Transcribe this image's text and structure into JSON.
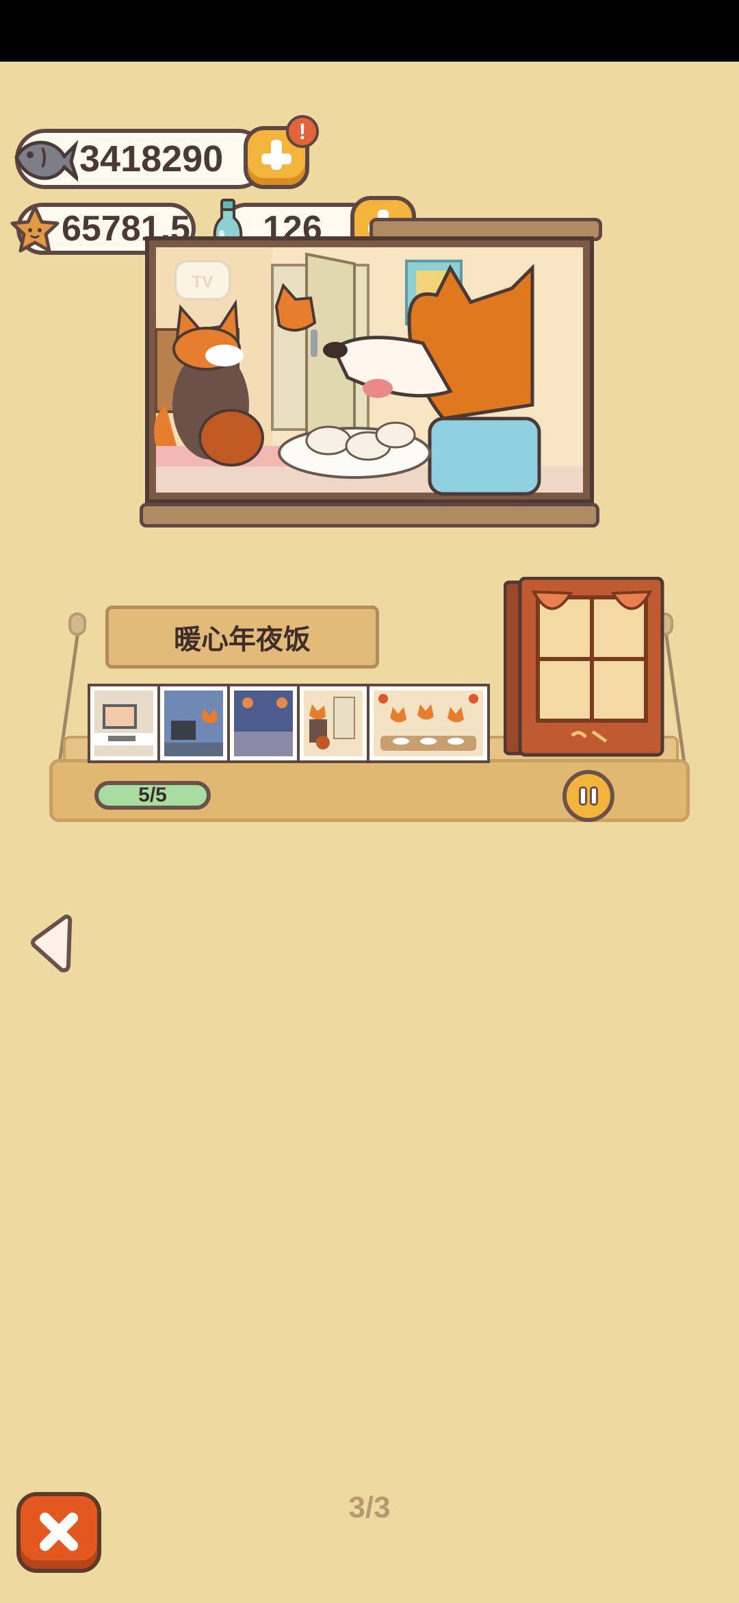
{
  "currencies": {
    "fish": {
      "value": "3418290",
      "icon": "fish-icon",
      "alert": "!"
    },
    "stars": {
      "value": "65781.5",
      "icon": "star-icon"
    },
    "bottles": {
      "value": "126",
      "icon": "bottle-icon"
    }
  },
  "scene": {
    "tv_label": "TV"
  },
  "album": {
    "title": "暖心年夜饭",
    "progress": "5/5",
    "progress_fraction": 1.0,
    "thumbnails": [
      "computer-desk-scene",
      "fox-at-computer-night",
      "night-window-scene",
      "fox-at-door-scene",
      "fox-family-dinner-scene"
    ]
  },
  "pager": {
    "text": "3/3"
  },
  "colors": {
    "background": "#eed9a0",
    "accent_orange": "#e2581f",
    "button_yellow": "#f2b43a",
    "outline_brown": "#5e4742",
    "progress_green": "#a8dca0"
  }
}
